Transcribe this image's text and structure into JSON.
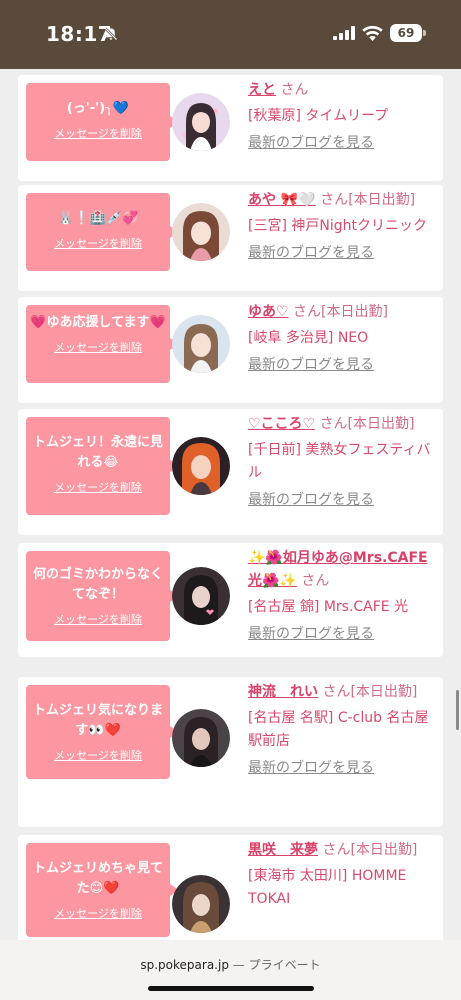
{
  "status_bar": {
    "time": "18:17",
    "battery": "69"
  },
  "items": [
    {
      "message": "(っ'-')╮💙",
      "delete_label": "メッセージを削除",
      "name": "えと",
      "suffix": "さん",
      "shop": "[秋葉原] タイムリープ",
      "blog": "最新のブログを見る"
    },
    {
      "message": "🐰❕🏥💉💞",
      "delete_label": "メッセージを削除",
      "name": "あや 🎀🤍",
      "suffix": "さん[本日出勤]",
      "shop": "[三宮] 神戸Nightクリニック",
      "blog": "最新のブログを見る"
    },
    {
      "message": "💗ゆあ応援してます💗",
      "delete_label": "メッセージを削除",
      "name": "ゆあ♡",
      "suffix": "さん[本日出勤]",
      "shop": "[岐阜 多治見] NEO",
      "blog": "最新のブログを見る"
    },
    {
      "message": "トムジェリ！永遠に見れる😂",
      "delete_label": "メッセージを削除",
      "name": "♡こころ♡",
      "suffix": "さん[本日出勤]",
      "shop": "[千日前] 美熟女フェスティバル",
      "blog": "最新のブログを見る"
    },
    {
      "message": "何のゴミかわからなくてなぞ！",
      "delete_label": "メッセージを削除",
      "name": "✨🌺如月ゆあ@Mrs.CAFE光🌺✨",
      "suffix": "さん",
      "shop": "[名古屋 錦] Mrs.CAFE 光",
      "blog": "最新のブログを見る"
    },
    {
      "message": "トムジェリ気になります👀❤️",
      "delete_label": "メッセージを削除",
      "name": "神流　れい",
      "suffix": "さん[本日出勤]",
      "shop": "[名古屋 名駅] C-club 名古屋駅前店",
      "blog": "最新のブログを見る"
    },
    {
      "message": "トムジェリめちゃ見てた😊❤️",
      "delete_label": "メッセージを削除",
      "name": "黒咲　来夢",
      "suffix": "さん[本日出勤]",
      "shop": "[東海市 太田川] HOMME TOKAI",
      "blog": ""
    }
  ],
  "browser": {
    "domain": "sp.pokepara.jp",
    "mode": "— プライベート"
  }
}
